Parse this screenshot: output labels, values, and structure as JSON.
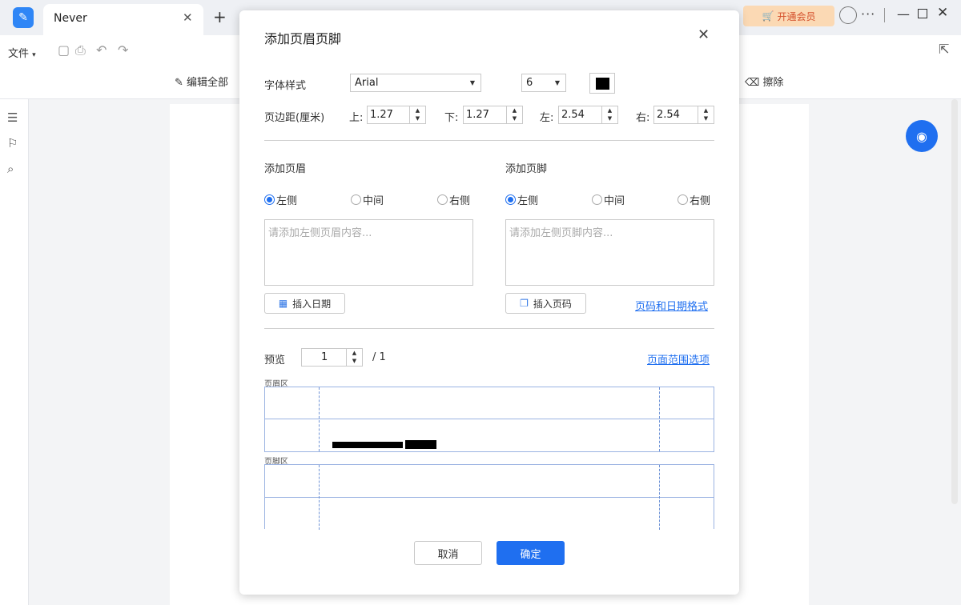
{
  "app": {
    "tab_title": "Never",
    "tab_close": "✕",
    "new_tab": "+",
    "vip_label": "开通会员",
    "more": "···"
  },
  "toolbar": {
    "file_menu": "文件",
    "edit_all": "编辑全部",
    "erase": "擦除"
  },
  "dialog": {
    "title": "添加页眉页脚",
    "font_style_label": "字体样式",
    "font_family_value": "Arial",
    "font_size_value": "6",
    "font_color": "#000000",
    "margin_label": "页边距(厘米)",
    "margin_top_label": "上:",
    "margin_top_value": "1.27",
    "margin_bottom_label": "下:",
    "margin_bottom_value": "1.27",
    "margin_left_label": "左:",
    "margin_left_value": "2.54",
    "margin_right_label": "右:",
    "margin_right_value": "2.54",
    "header": {
      "title": "添加页眉",
      "options": [
        "左侧",
        "中间",
        "右侧"
      ],
      "selected": "左侧",
      "placeholder": "请添加左侧页眉内容...",
      "insert_button": "插入日期"
    },
    "footer": {
      "title": "添加页脚",
      "options": [
        "左侧",
        "中间",
        "右侧"
      ],
      "selected": "左侧",
      "placeholder": "请添加左侧页脚内容...",
      "insert_button": "插入页码",
      "format_link": "页码和日期格式"
    },
    "preview_label": "预览",
    "preview_page_value": "1",
    "preview_total": "/ 1",
    "page_range_link": "页面范围选项",
    "header_area_label": "页眉区",
    "footer_area_label": "页脚区",
    "cancel_button": "取消",
    "ok_button": "确定"
  },
  "colors": {
    "accent": "#1f6ff0",
    "vip_bg": "#fbd9b4",
    "vip_text": "#d4502b"
  }
}
